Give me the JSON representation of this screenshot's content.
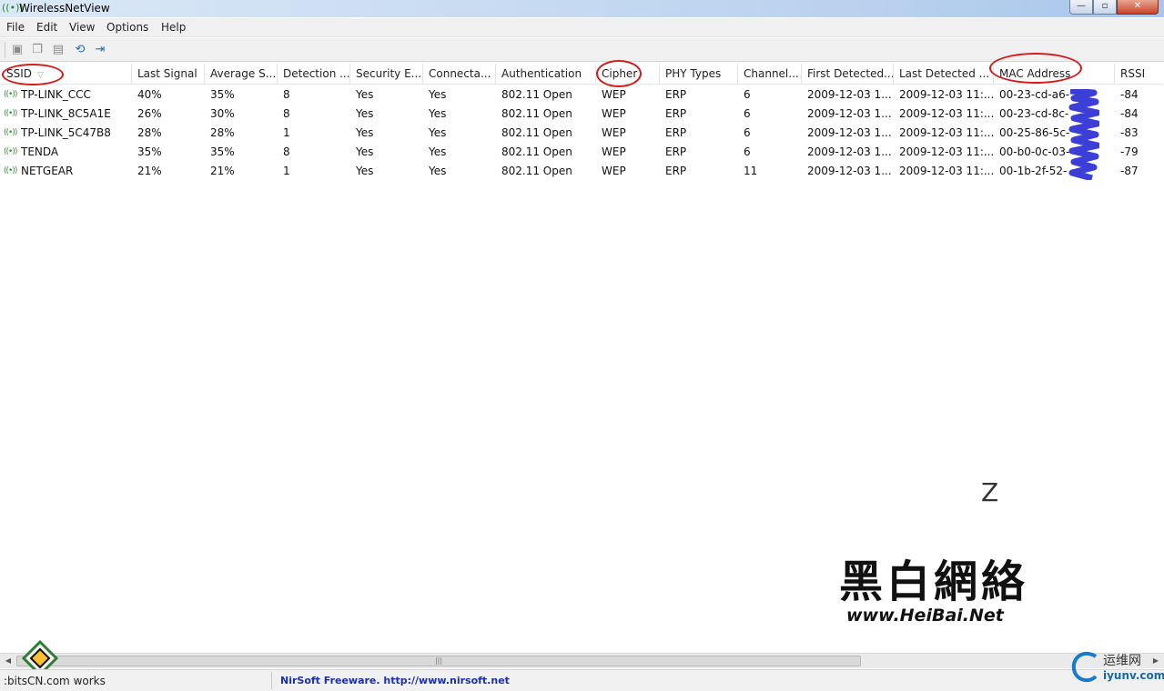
{
  "window": {
    "title": "WirelessNetView",
    "controls": {
      "minimize": "—",
      "maximize": "▫",
      "close": "✕"
    }
  },
  "menu": [
    "File",
    "Edit",
    "View",
    "Options",
    "Help"
  ],
  "toolbar": {
    "buttons": [
      "save-icon",
      "copy-icon",
      "properties-icon",
      "refresh-icon",
      "exit-icon"
    ]
  },
  "columns": [
    "SSID",
    "Last Signal",
    "Average S...",
    "Detection ...",
    "Security E...",
    "Connecta...",
    "Authentication",
    "Cipher",
    "PHY Types",
    "Channel...",
    "First Detected...",
    "Last Detected ...",
    "MAC Address",
    "RSSI"
  ],
  "rows": [
    [
      "TP-LINK_CCC",
      "40%",
      "35%",
      "8",
      "Yes",
      "Yes",
      "802.11 Open",
      "WEP",
      "ERP",
      "6",
      "2009-12-03 1...",
      "2009-12-03 11:...",
      "00-23-cd-a6-",
      "-84"
    ],
    [
      "TP-LINK_8C5A1E",
      "26%",
      "30%",
      "8",
      "Yes",
      "Yes",
      "802.11 Open",
      "WEP",
      "ERP",
      "6",
      "2009-12-03 1...",
      "2009-12-03 11:...",
      "00-23-cd-8c-",
      "-84"
    ],
    [
      "TP-LINK_5C47B8",
      "28%",
      "28%",
      "1",
      "Yes",
      "Yes",
      "802.11 Open",
      "WEP",
      "ERP",
      "6",
      "2009-12-03 1...",
      "2009-12-03 11:...",
      "00-25-86-5c-",
      "-83"
    ],
    [
      "TENDA",
      "35%",
      "35%",
      "8",
      "Yes",
      "Yes",
      "802.11 Open",
      "WEP",
      "ERP",
      "6",
      "2009-12-03 1...",
      "2009-12-03 11:...",
      "00-b0-0c-03-",
      "-79"
    ],
    [
      "NETGEAR",
      "21%",
      "21%",
      "1",
      "Yes",
      "Yes",
      "802.11 Open",
      "WEP",
      "ERP",
      "11",
      "2009-12-03 1...",
      "2009-12-03 11:...",
      "00-1b-2f-52-",
      "-87"
    ]
  ],
  "sort_indicator": "▽",
  "annotation_mark": "Z",
  "watermark": {
    "chinese": "黑白網絡",
    "url": "www.HeiBai.Net"
  },
  "status": {
    "left": ":bitsCN.com",
    "left_suffix": "works",
    "link": "NirSoft Freeware.  http://www.nirsoft.net"
  },
  "corner_logo": {
    "chinese": "运维网",
    "url": "iyunv.com"
  },
  "colors": {
    "annotation_red": "#d21c1c",
    "scribble_blue": "#3b3fd8",
    "link_blue": "#1a2fa8",
    "signal_green": "#2b9a2b"
  }
}
